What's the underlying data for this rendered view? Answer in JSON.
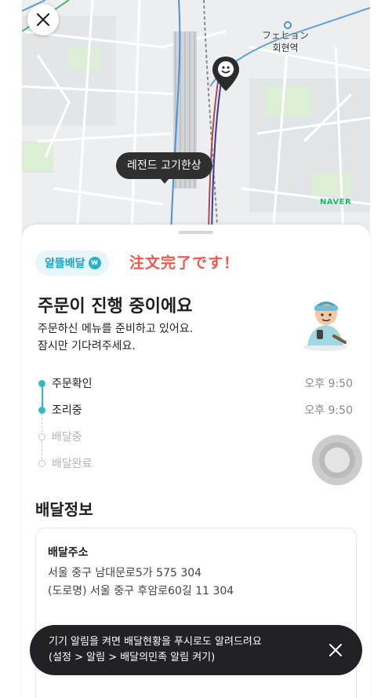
{
  "map": {
    "station_name": "フェヒョン",
    "station_name_kr": "회현역",
    "store_name": "레전드 고기한상",
    "provider": "NAVER"
  },
  "header": {
    "close_icon": "close-icon"
  },
  "badge": {
    "label": "알뜰배달",
    "icon": "w"
  },
  "overlay_text": "注文完了です！",
  "order": {
    "title": "주문이 진행 중이에요",
    "desc_line1": "주문하신 메뉴를 준비하고 있어요.",
    "desc_line2": "잠시만 기다려주세요."
  },
  "timeline": [
    {
      "label": "주문확인",
      "time": "오후 9:50",
      "status": "done"
    },
    {
      "label": "조리중",
      "time": "오후 9:50",
      "status": "done"
    },
    {
      "label": "배달중",
      "time": "",
      "status": "todo"
    },
    {
      "label": "배달완료",
      "time": "",
      "status": "todo"
    }
  ],
  "delivery": {
    "heading": "배달정보",
    "address_title": "배달주소",
    "address_line1": "서울 중구 남대문로5가 575 304",
    "address_line2": "(도로명) 서울 중구 후암로60길 11 304"
  },
  "toast": {
    "line1": "기기 알림을 켜면 배달현황을 푸시로도 알려드려요",
    "line2": "(설정 > 알림 > 배달의민족 알림 켜기)"
  },
  "colors": {
    "accent": "#33b8c6",
    "badge_text": "#1aa3c6",
    "jp_text": "#f0564b",
    "toast_bg": "#222226"
  }
}
